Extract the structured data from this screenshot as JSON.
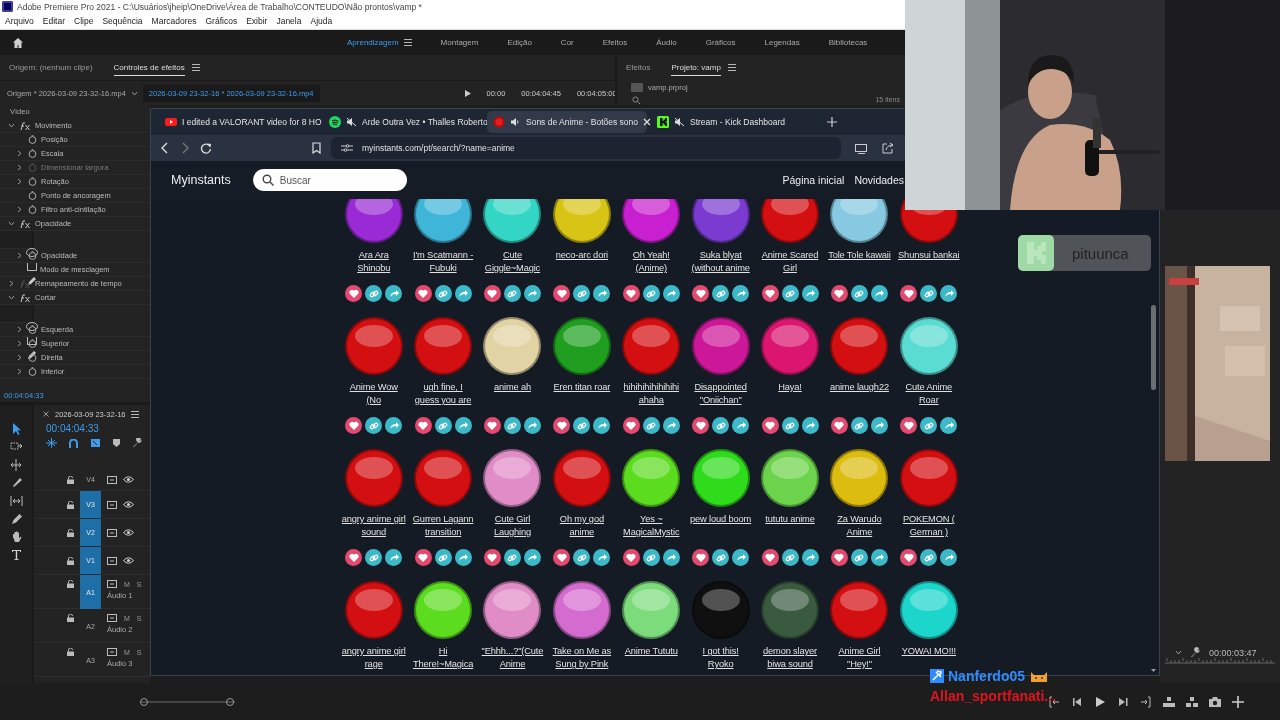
{
  "window": {
    "title": "Adobe Premiere Pro 2021 - C:\\Usuários\\jheip\\OneDrive\\Área de Trabalho\\CONTEUDO\\Não prontos\\vamp *"
  },
  "menu": [
    "Arquivo",
    "Editar",
    "Clipe",
    "Sequência",
    "Marcadores",
    "Gráficos",
    "Exibir",
    "Janela",
    "Ajuda"
  ],
  "workspaces": [
    {
      "label": "Aprendizagem",
      "selected": true
    },
    {
      "label": "Montagem",
      "selected": false
    },
    {
      "label": "Edição",
      "selected": false
    },
    {
      "label": "Cor",
      "selected": false
    },
    {
      "label": "Efeitos",
      "selected": false
    },
    {
      "label": "Áudio",
      "selected": false
    },
    {
      "label": "Gráficos",
      "selected": false
    },
    {
      "label": "Legendas",
      "selected": false
    },
    {
      "label": "Bibliotecas",
      "selected": false
    }
  ],
  "source_panel": {
    "tabs": [
      {
        "label": "Origem: (nenhum clipe)",
        "selected": false
      },
      {
        "label": "Controles de efeitos",
        "selected": true
      }
    ],
    "source_clip": "Origem * 2026-03-09 23-32-16.mp4",
    "sequence_clip": "2026-03-09 23-32-16 * 2026-03-09 23-32-16.mp4",
    "times": [
      "00:00",
      "00:04:04:45",
      "00:04:05:00"
    ],
    "section": "Vídeo",
    "effects": [
      {
        "name": "Movimento",
        "expanded": true,
        "disabled": false,
        "children": [
          {
            "kind": "property",
            "name": "Posição",
            "expandable": false,
            "disabled": false
          },
          {
            "kind": "property",
            "name": "Escala",
            "expandable": true,
            "disabled": false
          },
          {
            "kind": "property",
            "name": "Dimensionar largura",
            "expandable": true,
            "disabled": true
          },
          {
            "kind": "property",
            "name": "Rotação",
            "expandable": true,
            "disabled": false
          },
          {
            "kind": "property",
            "name": "Ponto de ancoragem",
            "expandable": false,
            "disabled": false
          },
          {
            "kind": "property",
            "name": "Filtro anti-cintilação",
            "expandable": true,
            "disabled": false
          }
        ]
      },
      {
        "name": "Opacidade",
        "expanded": true,
        "disabled": false,
        "children": [
          {
            "kind": "tools"
          },
          {
            "kind": "property",
            "name": "Opacidade",
            "expandable": true,
            "disabled": false
          },
          {
            "kind": "plain",
            "name": "Modo de mesclagem"
          }
        ]
      },
      {
        "name": "Remapeamento de tempo",
        "expanded": false,
        "disabled": true
      },
      {
        "name": "Cortar",
        "expanded": true,
        "disabled": false,
        "children": [
          {
            "kind": "tools"
          },
          {
            "kind": "property",
            "name": "Esquerda",
            "expandable": true,
            "disabled": false
          },
          {
            "kind": "property",
            "name": "Superior",
            "expandable": true,
            "disabled": false
          },
          {
            "kind": "property",
            "name": "Direita",
            "expandable": true,
            "disabled": false
          },
          {
            "kind": "property",
            "name": "Inferior",
            "expandable": true,
            "disabled": false
          }
        ]
      }
    ],
    "timecode": "00:04:04:33"
  },
  "project_panel": {
    "tabs": [
      {
        "label": "Efeitos",
        "selected": false
      },
      {
        "label": "Projeto: vamp",
        "selected": true
      }
    ],
    "file": "vamp.prproj",
    "count": "15 itens"
  },
  "timeline": {
    "title": "2026-03-09 23-32-16",
    "timecode": "00:04:04:33",
    "tracks": [
      {
        "kind": "video",
        "name": "V4",
        "targeted": false
      },
      {
        "kind": "video",
        "name": "V3",
        "targeted": true
      },
      {
        "kind": "video",
        "name": "V2",
        "targeted": true
      },
      {
        "kind": "video",
        "name": "V1",
        "targeted": true
      },
      {
        "kind": "audio",
        "name": "A1",
        "targeted": true,
        "label": "Áudio 1",
        "mute": "M",
        "solo": "S"
      },
      {
        "kind": "audio",
        "name": "A2",
        "targeted": false,
        "label": "Áudio 2",
        "mute": "M",
        "solo": "S"
      },
      {
        "kind": "audio",
        "name": "A3",
        "targeted": false,
        "label": "Áudio 3",
        "mute": "M",
        "solo": "S"
      }
    ]
  },
  "program": {
    "timecode": "00:00:03:47"
  },
  "browser": {
    "tabs": [
      {
        "kind": "youtube",
        "label": "I edited a VALORANT video for 8 HO",
        "muted": false,
        "selected": false
      },
      {
        "kind": "spotify",
        "label": "Arde Outra Vez • Thalles Roberto",
        "muted": true,
        "selected": false
      },
      {
        "kind": "site",
        "label": "Sons de Anime - Botões sono",
        "muted": false,
        "selected": true
      },
      {
        "kind": "kick",
        "label": "Stream - Kick Dashboard",
        "muted": true,
        "selected": false
      }
    ],
    "url": "myinstants.com/pt/search/?name=anime",
    "site": {
      "logo": "Myinstants",
      "search_placeholder": "Buscar",
      "nav": [
        "Página inicial",
        "Novidades"
      ]
    },
    "sounds": [
      {
        "name": "Ara Ara Shinobu",
        "color": "#9a2ad6"
      },
      {
        "name": "I'm Scatmann - Fubuki",
        "color": "#3fb6d8"
      },
      {
        "name": "Cute Giggle~Magic",
        "color": "#33d6c4"
      },
      {
        "name": "neco-arc dori",
        "color": "#d8c414"
      },
      {
        "name": "Oh Yeah! (Anime)",
        "color": "#c81fd0"
      },
      {
        "name": "Suka blyat (without anime",
        "color": "#7b3bd0"
      },
      {
        "name": "Anime Scared Girl",
        "color": "#d40f12"
      },
      {
        "name": "Tole Tole kawaii",
        "color": "#86c9e0"
      },
      {
        "name": "Shunsui bankai",
        "color": "#d40f12"
      },
      {
        "name": "Anime Wow (No",
        "color": "#d40f12"
      },
      {
        "name": "ugh fine, I guess you are",
        "color": "#d40f12"
      },
      {
        "name": "anime ah",
        "color": "#e2d3a4"
      },
      {
        "name": "Eren titan roar",
        "color": "#1f9e1f"
      },
      {
        "name": "hihihihihihihihi ahaha",
        "color": "#d40f12"
      },
      {
        "name": "Disappointed \"Oniichan\"",
        "color": "#cc1898"
      },
      {
        "name": "Haya!",
        "color": "#dc1670"
      },
      {
        "name": "anime laugh22",
        "color": "#d40f12"
      },
      {
        "name": "Cute Anime Roar",
        "color": "#5adcd2"
      },
      {
        "name": "angry anime girl sound",
        "color": "#d40f12"
      },
      {
        "name": "Gurren Lagann transition",
        "color": "#d40f12"
      },
      {
        "name": "Cute Girl Laughing",
        "color": "#e08cc6"
      },
      {
        "name": "Oh my god anime",
        "color": "#d40f12"
      },
      {
        "name": "Yes ~ MagicalMystic",
        "color": "#5cdc1e"
      },
      {
        "name": "pew loud boom",
        "color": "#2fdc1c"
      },
      {
        "name": "tututu anime",
        "color": "#6cd44c"
      },
      {
        "name": "Za Warudo Anime",
        "color": "#dcbc0e"
      },
      {
        "name": "POKEMON ( German )",
        "color": "#d40f12"
      },
      {
        "name": "angry anime girl rage",
        "color": "#d40f12"
      },
      {
        "name": "Hi There!~Magica",
        "color": "#5cdc1e"
      },
      {
        "name": "\"Ehhh...?\"(Cute Anime",
        "color": "#e08cc6"
      },
      {
        "name": "Take on Me as Sung by Pink",
        "color": "#d46cd0"
      },
      {
        "name": "Anime Tututu",
        "color": "#7cdc7c"
      },
      {
        "name": "I got this! Ryoko",
        "color": "#101010"
      },
      {
        "name": "demon slayer biwa sound",
        "color": "#3a5a40"
      },
      {
        "name": "Anime Girl \"Hey!\"",
        "color": "#d40f12"
      },
      {
        "name": "YOWAI MO!!!",
        "color": "#1cd6cc"
      }
    ]
  },
  "stream_overlay": {
    "alert_name": "pituunca",
    "chat": [
      {
        "name": "Nanferdo05",
        "color": "#2d8cff"
      },
      {
        "name": "Allan_sportfanati...",
        "color": "#e0141e"
      }
    ]
  }
}
